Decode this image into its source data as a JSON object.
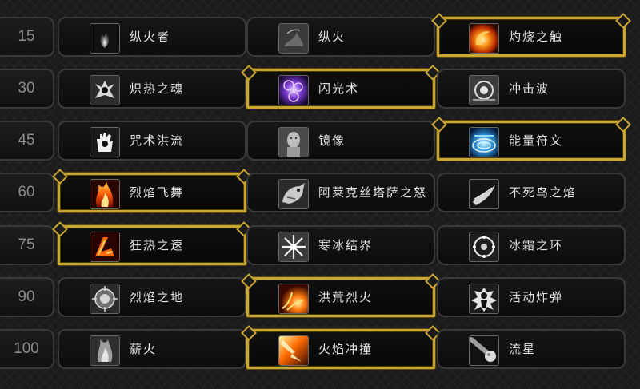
{
  "talent_rows": [
    {
      "level": "15",
      "choices": [
        {
          "name": "纵火者",
          "icon": "pyromaniac-icon",
          "selected": false
        },
        {
          "name": "纵火",
          "icon": "conflagration-icon",
          "selected": false
        },
        {
          "name": "灼烧之触",
          "icon": "searing-touch-icon",
          "selected": true
        }
      ]
    },
    {
      "level": "30",
      "choices": [
        {
          "name": "炽热之魂",
          "icon": "blazing-soul-icon",
          "selected": false
        },
        {
          "name": "闪光术",
          "icon": "shimmer-icon",
          "selected": true
        },
        {
          "name": "冲击波",
          "icon": "blast-wave-icon",
          "selected": false
        }
      ]
    },
    {
      "level": "45",
      "choices": [
        {
          "name": "咒术洪流",
          "icon": "incanters-flow-icon",
          "selected": false
        },
        {
          "name": "镜像",
          "icon": "mirror-image-icon",
          "selected": false
        },
        {
          "name": "能量符文",
          "icon": "rune-of-power-icon",
          "selected": true
        }
      ]
    },
    {
      "level": "60",
      "choices": [
        {
          "name": "烈焰飞舞",
          "icon": "flame-on-icon",
          "selected": true
        },
        {
          "name": "阿莱克丝塔萨之怒",
          "icon": "alexstraszas-fury-icon",
          "selected": false
        },
        {
          "name": "不死鸟之焰",
          "icon": "phoenix-flames-icon",
          "selected": false
        }
      ]
    },
    {
      "level": "75",
      "choices": [
        {
          "name": "狂热之速",
          "icon": "frenetic-speed-icon",
          "selected": true
        },
        {
          "name": "寒冰结界",
          "icon": "ice-ward-icon",
          "selected": false
        },
        {
          "name": "冰霜之环",
          "icon": "ring-of-frost-icon",
          "selected": false
        }
      ]
    },
    {
      "level": "90",
      "choices": [
        {
          "name": "烈焰之地",
          "icon": "flame-patch-icon",
          "selected": false
        },
        {
          "name": "洪荒烈火",
          "icon": "conflagration-burst-icon",
          "selected": true
        },
        {
          "name": "活动炸弹",
          "icon": "living-bomb-icon",
          "selected": false
        }
      ]
    },
    {
      "level": "100",
      "choices": [
        {
          "name": "薪火",
          "icon": "kindling-icon",
          "selected": false
        },
        {
          "name": "火焰冲撞",
          "icon": "pyroclasm-icon",
          "selected": true
        },
        {
          "name": "流星",
          "icon": "meteor-icon",
          "selected": false
        }
      ]
    }
  ],
  "colors": {
    "selected_border": "#caa632",
    "text": "#e4e4e4",
    "level_text": "#8d8d8d"
  }
}
